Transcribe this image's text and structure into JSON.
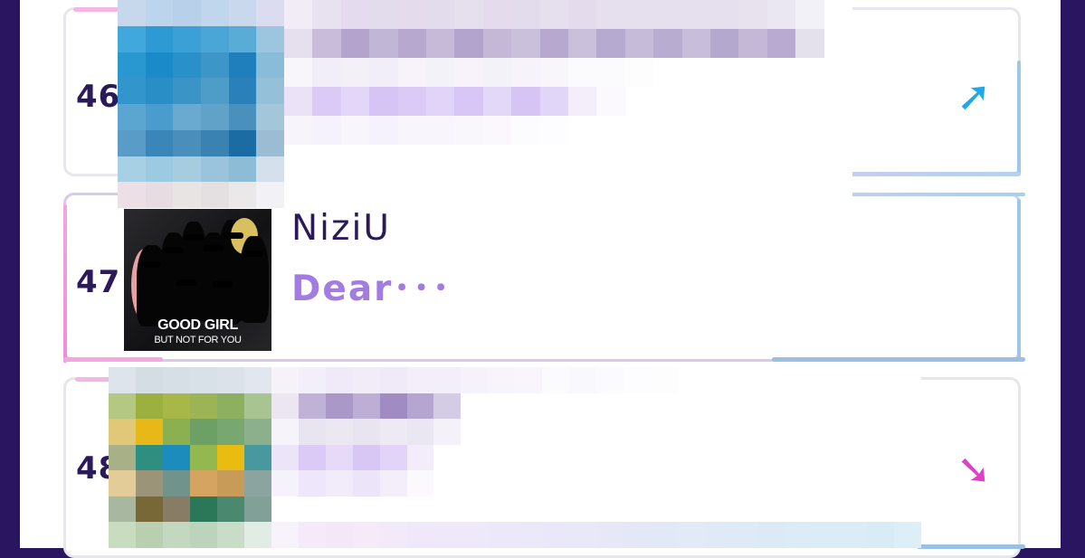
{
  "colors": {
    "background": "#2a1660",
    "rank_text": "#2b1a5a",
    "artist_text": "#2b1a5a",
    "title_text": "#a27ce0",
    "up_arrow": "#20a8e8",
    "down_arrow": "#e040c8"
  },
  "chart": {
    "entries": [
      {
        "rank": "46",
        "trend_icon": "arrow-up-right-icon",
        "trend_glyph": "➚",
        "blurred": true
      },
      {
        "rank": "47",
        "artist": "NiziU",
        "title": "Dear･･･",
        "cover": {
          "line1": "GOOD GIRL",
          "line2": "BUT NOT FOR YOU"
        },
        "blurred": false
      },
      {
        "rank": "48",
        "trend_icon": "arrow-down-right-icon",
        "trend_glyph": "➘",
        "blurred": true
      }
    ]
  }
}
